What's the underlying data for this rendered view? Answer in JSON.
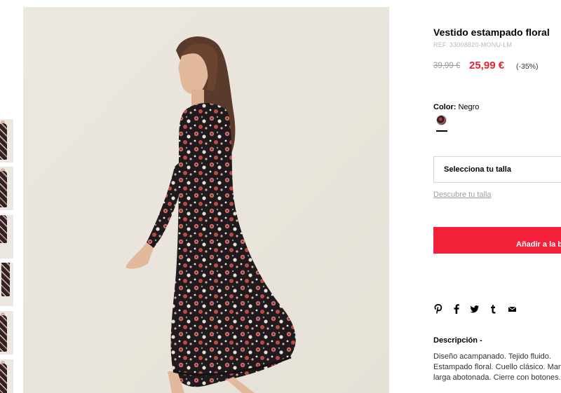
{
  "product": {
    "title": "Vestido estampado floral",
    "ref": "REF. 33008820-MONU-LM",
    "price_old": "39,99 €",
    "price_new": "25,99 €",
    "discount": "(-35%)",
    "color_label": "Color:",
    "color_value": "Negro",
    "size_select": "Selecciona tu talla",
    "size_guide": "Descubre tu talla",
    "add_to_bag": "Añadir a la b",
    "description_title": "Descripción -",
    "description": "Diseño acampanado. Tejido fluido. Estampado floral. Cuello clásico. Manga larga abotonada. Cierre con botones."
  },
  "social": [
    "pinterest-icon",
    "facebook-icon",
    "twitter-icon",
    "tumblr-icon",
    "email-icon"
  ],
  "colors": {
    "accent": "#f3203a",
    "price": "#e8212e"
  },
  "thumbnails": 6
}
